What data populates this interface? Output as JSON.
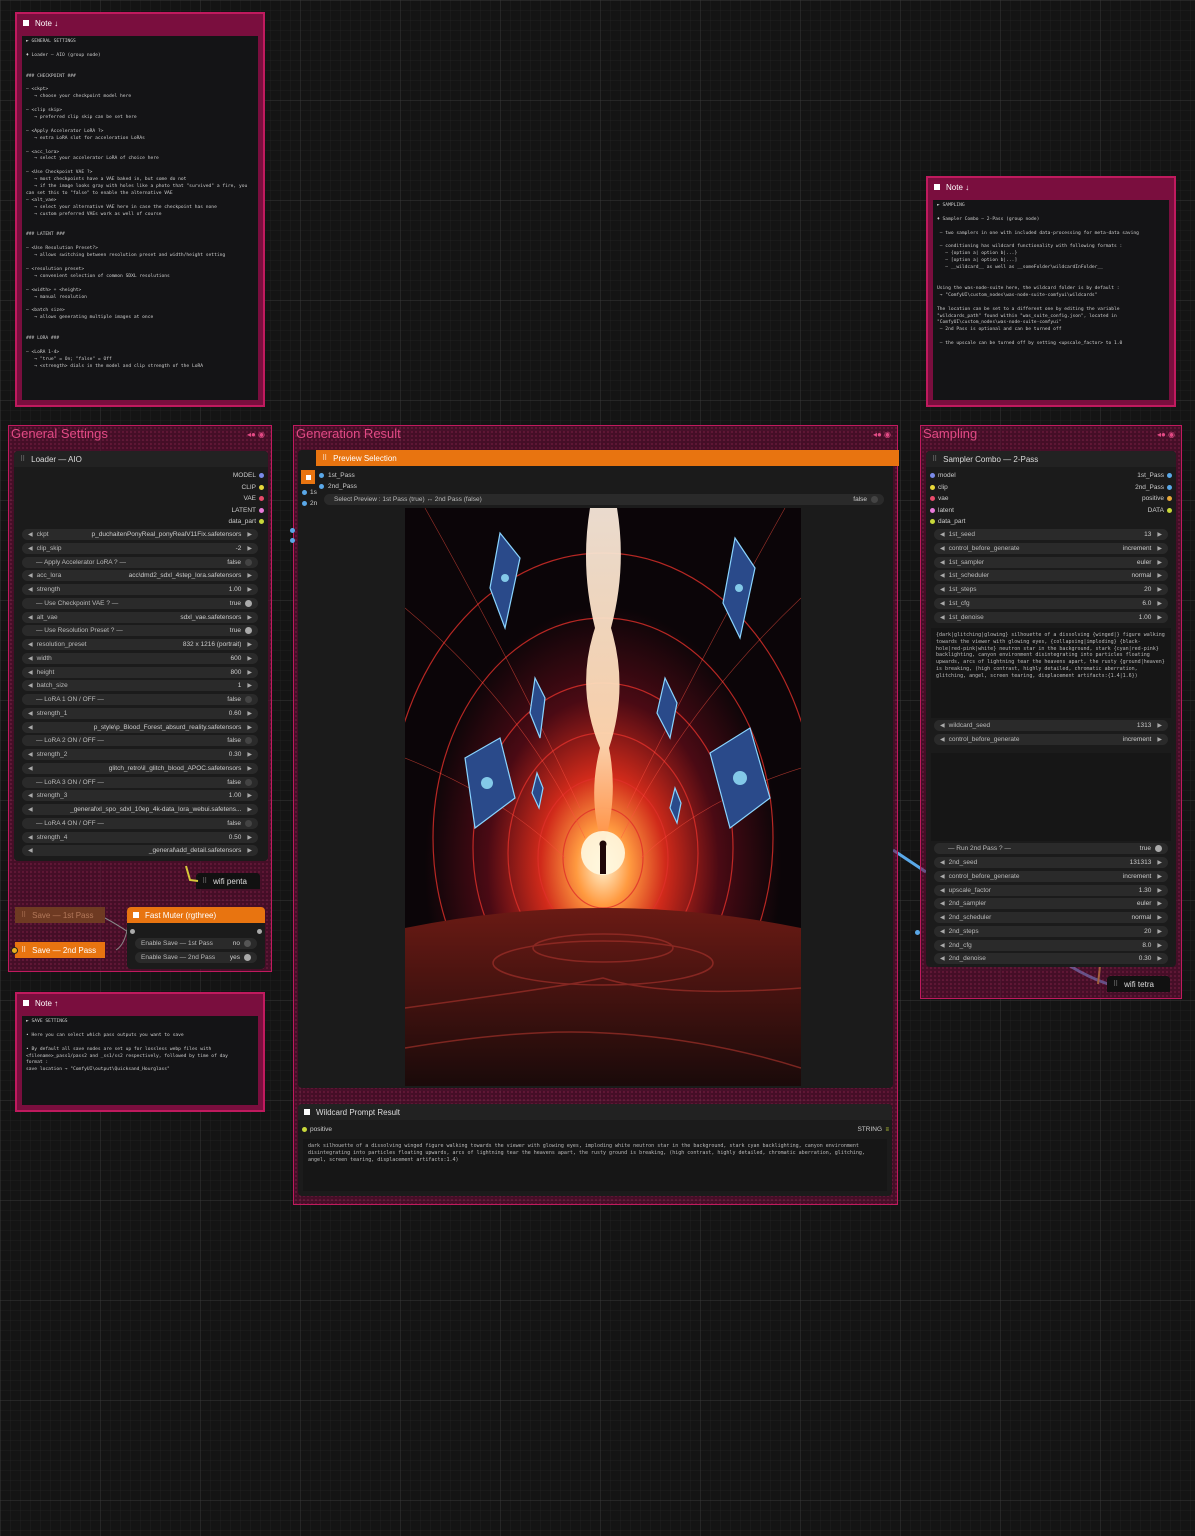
{
  "note_general": {
    "title": "Note ↓",
    "text": "► GENERAL SETTINGS\n\n♦ Loader — AIO (group node)\n\n\n### CHECKPOINT ###\n\n— <ckpt>\n   → choose your checkpoint model here\n\n— <clip skip>\n   → preferred clip skip can be set here\n\n— <Apply Accelerator LoRA ?>\n   → extra LoRA slot for acceleration LoRAs\n\n— <acc_lora>\n   → select your accelerator LoRA of choice here\n\n— <Use Checkpoint VAE ?>\n   → most checkpoints have a VAE baked in, but some do not\n   → if the image looks gray with holes like a photo that \"survived\" a fire, you\ncan set this to \"false\" to enable the alternative VAE\n— <alt_vae>\n   → select your alternative VAE here in case the checkpoint has none\n   → custom preferred VAEs work as well of course\n\n\n### LATENT ###\n\n— <Use Resolution Preset?>\n   → allows switching between resolution preset and width/height setting\n\n— <resolution preset>\n   → convenient selection of common SDXL resolutions\n\n— <width> + <height>\n   → manual resolution\n\n— <batch size>\n   → allows generating multiple images at once\n\n\n### LORA ###\n\n— <LoRA 1-4>\n   → \"true\" = On; \"false\" = Off\n   → <strength> dials in the model and clip strength of the LoRA"
  },
  "note_sampling": {
    "title": "Note ↓",
    "text": "► SAMPLING\n\n♦ Sampler Combo — 2-Pass (group node)\n\n — two samplers in one with included data-processing for meta-data saving\n\n — conditioning has wildcard functionality with following formats :\n   — {option a| option b|...}\n   — [option a| option b|...]\n   — __wildcard__ as well as __someFolder\\wildcardInFolder__\n\n\nUsing the was-node-suite here, the wildcard folder is by default :\n → \"ComfyUI\\custom_nodes\\was-node-suite-comfyui\\wildcards\"\n\nThe location can be set to a different one by editing the variable\n\"wildcards_path\" found within \"was_suite_config.json\", located in\n\"ComfyUI\\custom_nodes\\was-node-suite-comfyui\"\n — 2nd Pass is optional and can be turned off\n\n — the upscale can be turned off by setting <upscale_factor> to 1.0"
  },
  "note_save": {
    "title": "Note ↑",
    "text": "► SAVE SETTINGS\n\n• Here you can select which pass outputs you want to save\n\n• By default all save nodes are set up for lossless webp files with\n<filename>_pass1/pass2 and _ss1/ss2 respectively, followed by time of day\nformat :\nsave location → \"ComfyUI\\output\\Quicksand_Hourglass\""
  },
  "groups": {
    "general": "General Settings",
    "generation": "Generation Result",
    "sampling": "Sampling"
  },
  "loader": {
    "title": "Loader — AIO",
    "outputs": [
      "MODEL",
      "CLIP",
      "VAE",
      "LATENT",
      "data_part"
    ],
    "widgets": [
      {
        "label": "ckpt",
        "value": "p_duchaitenPonyReal_ponyRealV11Fix.safetensors"
      },
      {
        "label": "clip_skip",
        "value": "-2"
      },
      {
        "label": "— Apply Accelerator LoRA ? —",
        "value": "false",
        "toggle": true
      },
      {
        "label": "acc_lora",
        "value": "acc\\dmd2_sdxl_4step_lora.safetensors"
      },
      {
        "label": "strength",
        "value": "1.00"
      },
      {
        "label": "— Use Checkpoint VAE ? —",
        "value": "true",
        "toggle": true
      },
      {
        "label": "alt_vae",
        "value": "sdxl_vae.safetensors"
      },
      {
        "label": "— Use Resolution Preset ? —",
        "value": "true",
        "toggle": true
      },
      {
        "label": "resolution_preset",
        "value": "832 x 1216  (portrait)"
      },
      {
        "label": "width",
        "value": "600"
      },
      {
        "label": "height",
        "value": "800"
      },
      {
        "label": "batch_size",
        "value": "1"
      },
      {
        "label": "— LoRA 1 ON / OFF —",
        "value": "false",
        "toggle": true
      },
      {
        "label": "strength_1",
        "value": "0.60"
      },
      {
        "label": "",
        "value": "p_style\\p_Blood_Forest_absurd_reality.safetensors"
      },
      {
        "label": "— LoRA 2 ON / OFF —",
        "value": "false",
        "toggle": true
      },
      {
        "label": "strength_2",
        "value": "0.30"
      },
      {
        "label": "",
        "value": "glitch_retro\\il_glitch_blood_APOC.safetensors"
      },
      {
        "label": "— LoRA 3 ON / OFF —",
        "value": "false",
        "toggle": true
      },
      {
        "label": "strength_3",
        "value": "1.00"
      },
      {
        "label": "",
        "value": "_general\\xl_spo_sdxl_10ep_4k-data_lora_webui.safetens..."
      },
      {
        "label": "— LoRA 4 ON / OFF —",
        "value": "false",
        "toggle": true
      },
      {
        "label": "strength_4",
        "value": "0.50"
      },
      {
        "label": "",
        "value": "_general\\add_detail.safetensors"
      }
    ]
  },
  "wifi_penta": "wifi penta",
  "save_nodes": {
    "save1": "Save — 1st Pass",
    "save2": "Save — 2nd Pass",
    "muter": "Fast Muter (rgthree)",
    "enable1_label": "Enable Save — 1st Pass",
    "enable1_value": "no",
    "enable2_label": "Enable Save — 2nd Pass",
    "enable2_value": "yes"
  },
  "preview": {
    "title": "Preview Selection",
    "inputs": [
      "1st_Pass",
      "2nd_Pass"
    ],
    "select_label": "Select Preview : 1st Pass (true) ↔ 2nd Pass (false)",
    "select_value": "false",
    "side_inputs": [
      "1s",
      "2n"
    ]
  },
  "wildcard": {
    "title": "Wildcard Prompt Result",
    "input": "positive",
    "output": "STRING",
    "text": "dark silhouette of a dissolving winged figure walking towards the viewer with glowing eyes, imploding white neutron star in the background, stark cyan backlighting, canyon environment disintegrating into particles floating upwards, arcs of lightning tear the heavens apart, the rusty ground is breaking, (high contrast, highly detailed, chromatic aberration, glitching, angel, screen tearing, displacement artifacts:1.4)"
  },
  "sampler": {
    "title": "Sampler Combo — 2-Pass",
    "inputs": [
      "model",
      "clip",
      "vae",
      "latent",
      "data_part"
    ],
    "outputs": [
      "1st_Pass",
      "2nd_Pass",
      "positive",
      "DATA"
    ],
    "widgets1": [
      {
        "label": "1st_seed",
        "value": "13"
      },
      {
        "label": "control_before_generate",
        "value": "increment"
      },
      {
        "label": "1st_sampler",
        "value": "euler"
      },
      {
        "label": "1st_scheduler",
        "value": "normal"
      },
      {
        "label": "1st_steps",
        "value": "20"
      },
      {
        "label": "1st_cfg",
        "value": "6.0"
      },
      {
        "label": "1st_denoise",
        "value": "1.00"
      }
    ],
    "prompt": "{dark|glitching|glowing} silhouette of a dissolving {winged|} figure walking towards the viewer with glowing eyes, {collapsing|imploding} {black-hole|red-pink|white} neutron star in the background, stark {cyan|red-pink} backlighting, canyon environment disintegrating into particles floating upwards, arcs of lightning tear the heavens apart, the rusty {ground|heaven} is breaking, (high contrast, highly detailed, chromatic aberration, glitching, angel, screen tearing, displacement artifacts:{1.4|1.6})",
    "widgets2": [
      {
        "label": "wildcard_seed",
        "value": "1313"
      },
      {
        "label": "control_before_generate",
        "value": "increment"
      }
    ],
    "run2_label": "— Run 2nd Pass ? —",
    "run2_value": "true",
    "widgets3": [
      {
        "label": "2nd_seed",
        "value": "131313"
      },
      {
        "label": "control_before_generate",
        "value": "increment"
      },
      {
        "label": "upscale_factor",
        "value": "1.30"
      },
      {
        "label": "2nd_sampler",
        "value": "euler"
      },
      {
        "label": "2nd_scheduler",
        "value": "normal"
      },
      {
        "label": "2nd_steps",
        "value": "20"
      },
      {
        "label": "2nd_cfg",
        "value": "8.0"
      },
      {
        "label": "2nd_denoise",
        "value": "0.30"
      }
    ]
  },
  "wifi_tetra": "wifi tetra",
  "colors": {
    "group_border": "#c01a5e",
    "note_bg": "#7a0e3e",
    "orange": "#e87410",
    "cyan_link": "#5aa8e8",
    "yellow_link": "#d7c93a"
  }
}
